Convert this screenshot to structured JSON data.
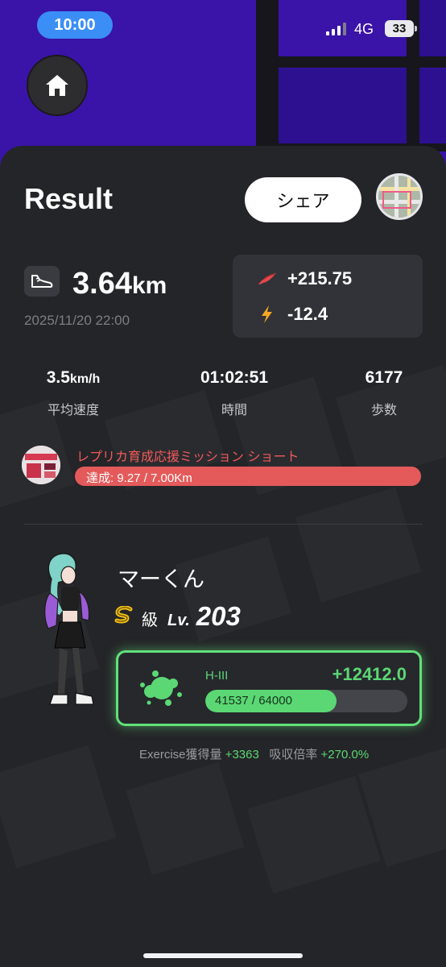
{
  "status_bar": {
    "time": "10:00",
    "network": "4G",
    "battery": "33"
  },
  "header": {
    "title": "Result",
    "share_label": "シェア"
  },
  "run": {
    "distance_value": "3.64",
    "distance_unit": "km",
    "datetime": "2025/11/20 22:00",
    "reward_1": "+215.75",
    "reward_2": "-12.4"
  },
  "stats": [
    {
      "value": "3.5",
      "unit": "km/h",
      "label": "平均速度"
    },
    {
      "value": "01:02:51",
      "unit": "",
      "label": "時間"
    },
    {
      "value": "6177",
      "unit": "",
      "label": "歩数"
    }
  ],
  "mission": {
    "title": "レプリカ育成応援ミッション ショート",
    "progress": "達成: 9.27 / 7.00Km"
  },
  "character": {
    "name": "マーくん",
    "rank_suffix": "級",
    "level_label": "Lv.",
    "level": "203"
  },
  "gene": {
    "name": "H-III",
    "gain": "+12412.0",
    "progress": "41537 / 64000",
    "progress_fraction": 0.649
  },
  "footer": {
    "exercise_label": "Exercise獲得量",
    "exercise_value": "+3363",
    "absorb_label": "吸収倍率",
    "absorb_value": "+270.0%"
  },
  "colors": {
    "map_bg": "#3a13a8",
    "accent_green": "#5bd874",
    "mission_red": "#e45a5a",
    "time_pill": "#3a8ef5"
  }
}
